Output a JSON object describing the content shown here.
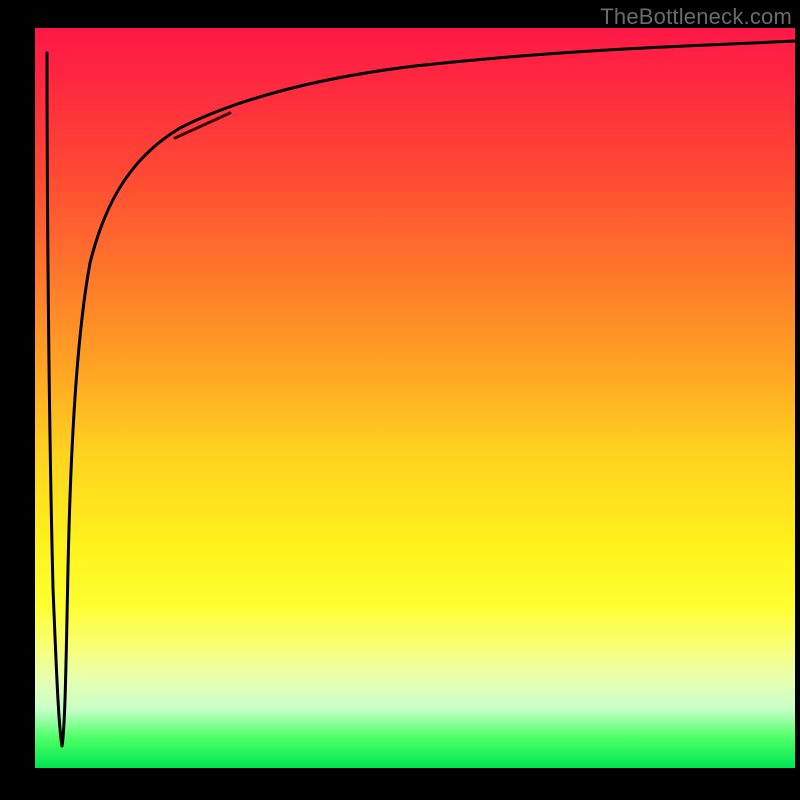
{
  "attribution": "TheBottleneck.com",
  "colors": {
    "background": "#000000",
    "curve": "#000000",
    "smear": "#c88a80",
    "gradient_top": "#ff1846",
    "gradient_mid": "#ffe21a",
    "gradient_bottom": "#00e651"
  },
  "chart_data": {
    "type": "line",
    "title": "",
    "xlabel": "",
    "ylabel": "",
    "xlim": [
      0,
      100
    ],
    "ylim": [
      0,
      100
    ],
    "series": [
      {
        "name": "bottleneck-curve",
        "x": [
          1,
          2,
          2.5,
          3,
          3.4,
          3.8,
          4.5,
          6,
          8,
          11,
          15,
          21,
          28,
          40,
          55,
          70,
          85,
          100
        ],
        "y": [
          97,
          60,
          30,
          4,
          30,
          55,
          70,
          79,
          84,
          88,
          91,
          93,
          94.5,
          95.5,
          96.2,
          96.7,
          97,
          97.2
        ]
      }
    ],
    "annotations": [
      {
        "name": "smear-mark",
        "x": 22,
        "y": 89
      }
    ]
  }
}
